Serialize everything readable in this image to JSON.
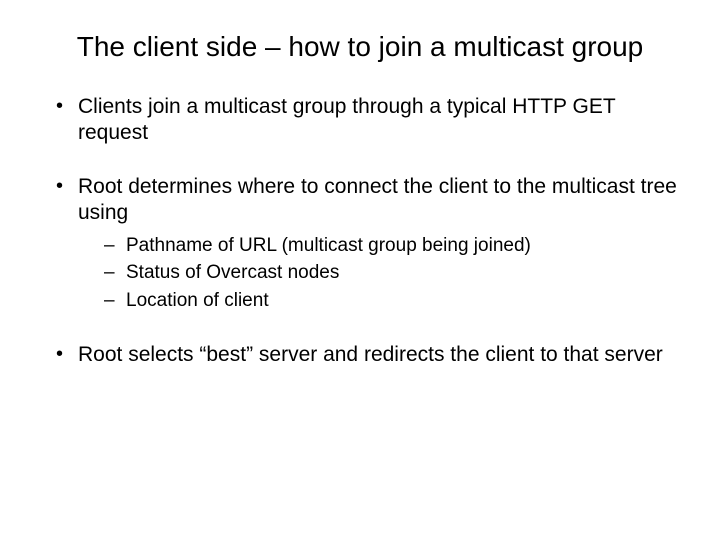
{
  "title": "The client side – how to join a multicast group",
  "bullets": [
    {
      "text": "Clients join a multicast group through a typical HTTP GET request",
      "sub": []
    },
    {
      "text": "Root determines where to connect the client to the multicast tree using",
      "sub": [
        "Pathname of URL (multicast group being joined)",
        "Status of Overcast nodes",
        "Location of client"
      ]
    },
    {
      "text": "Root selects “best” server and redirects the client to that server",
      "sub": []
    }
  ]
}
